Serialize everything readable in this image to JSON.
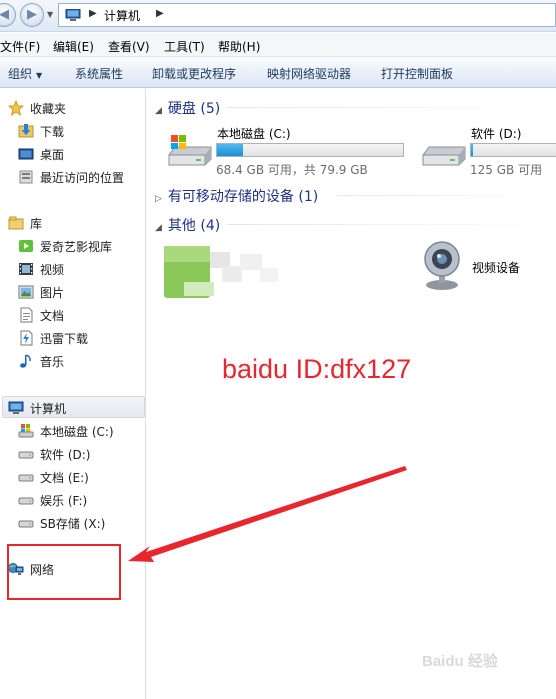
{
  "address": {
    "path": "计算机"
  },
  "menu": [
    "文件(F)",
    "编辑(E)",
    "查看(V)",
    "工具(T)",
    "帮助(H)"
  ],
  "toolbar": {
    "organize": "组织",
    "items": [
      "系统属性",
      "卸载或更改程序",
      "映射网络驱动器",
      "打开控制面板"
    ]
  },
  "sidebar": {
    "favorites": {
      "label": "收藏夹",
      "items": [
        "下载",
        "桌面",
        "最近访问的位置"
      ]
    },
    "libraries": {
      "label": "库",
      "items": [
        "爱奇艺影视库",
        "视频",
        "图片",
        "文档",
        "迅雷下载",
        "音乐"
      ]
    },
    "computer": {
      "label": "计算机",
      "items": [
        "本地磁盘 (C:)",
        "软件 (D:)",
        "文档 (E:)",
        "娱乐 (F:)",
        "SB存储 (X:)"
      ]
    },
    "network": {
      "label": "网络"
    }
  },
  "main": {
    "hard_disks": {
      "header": "硬盘 (5)",
      "drives": [
        {
          "name": "本地磁盘 (C:)",
          "free": "68.4 GB 可用，共 79.9 GB",
          "used_fraction": 0.14
        },
        {
          "name": "软件 (D:)",
          "free": "125 GB 可用",
          "used_fraction": 0.02
        }
      ]
    },
    "removable": {
      "header": "有可移动存储的设备 (1)"
    },
    "other": {
      "header": "其他 (4)",
      "webcam_label": "视频设备"
    }
  },
  "annotation": {
    "text": "baidu ID:dfx127",
    "color": "#e8262e"
  },
  "watermark": {
    "text": "Baidu 经验"
  },
  "icons": {
    "favorites": "star-icon",
    "downloads": "download-folder-icon",
    "desktop": "desktop-icon",
    "recent": "recent-places-icon",
    "library": "library-icon",
    "computer": "computer-icon",
    "drive": "drive-icon",
    "network": "network-icon",
    "webcam": "webcam-icon"
  }
}
